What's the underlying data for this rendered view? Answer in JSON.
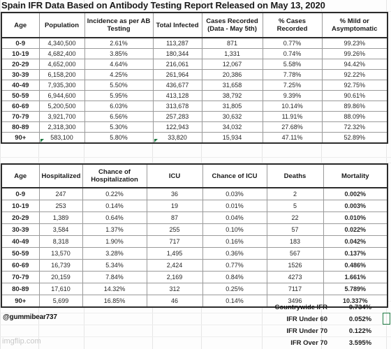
{
  "document": {
    "title": "Spain IFR Data Based on Antibody Testing Report Released on May 13, 2020",
    "username": "@gummibear737",
    "watermark": "imgflip.com",
    "accent_green": "#1f7a43",
    "border_color": "#2b2b2b"
  },
  "table_ifr": {
    "name": "Spain IFR antibody testing table",
    "headers": [
      "Age",
      "Population",
      "Incidence as per AB Testing",
      "Total Infected",
      "Cases Recorded (Data - May 5th)",
      "% Cases Recorded",
      "% Mild or Asymptomatic"
    ],
    "rows": [
      {
        "age": "0-9",
        "population": "4,340,500",
        "incidence": "2.61%",
        "total_infected": "113,287",
        "cases_recorded": "871",
        "pct_cases_recorded": "0.77%",
        "pct_mild": "99.23%"
      },
      {
        "age": "10-19",
        "population": "4,682,400",
        "incidence": "3.85%",
        "total_infected": "180,344",
        "cases_recorded": "1,331",
        "pct_cases_recorded": "0.74%",
        "pct_mild": "99.26%"
      },
      {
        "age": "20-29",
        "population": "4,652,000",
        "incidence": "4.64%",
        "total_infected": "216,061",
        "cases_recorded": "12,067",
        "pct_cases_recorded": "5.58%",
        "pct_mild": "94.42%"
      },
      {
        "age": "30-39",
        "population": "6,158,200",
        "incidence": "4.25%",
        "total_infected": "261,964",
        "cases_recorded": "20,386",
        "pct_cases_recorded": "7.78%",
        "pct_mild": "92.22%"
      },
      {
        "age": "40-49",
        "population": "7,935,300",
        "incidence": "5.50%",
        "total_infected": "436,677",
        "cases_recorded": "31,658",
        "pct_cases_recorded": "7.25%",
        "pct_mild": "92.75%"
      },
      {
        "age": "50-59",
        "population": "6,944,600",
        "incidence": "5.95%",
        "total_infected": "413,128",
        "cases_recorded": "38,792",
        "pct_cases_recorded": "9.39%",
        "pct_mild": "90.61%"
      },
      {
        "age": "60-69",
        "population": "5,200,500",
        "incidence": "6.03%",
        "total_infected": "313,678",
        "cases_recorded": "31,805",
        "pct_cases_recorded": "10.14%",
        "pct_mild": "89.86%"
      },
      {
        "age": "70-79",
        "population": "3,921,700",
        "incidence": "6.56%",
        "total_infected": "257,283",
        "cases_recorded": "30,632",
        "pct_cases_recorded": "11.91%",
        "pct_mild": "88.09%"
      },
      {
        "age": "80-89",
        "population": "2,318,300",
        "incidence": "5.30%",
        "total_infected": "122,943",
        "cases_recorded": "34,032",
        "pct_cases_recorded": "27.68%",
        "pct_mild": "72.32%"
      },
      {
        "age": "90+",
        "population": "583,100",
        "incidence": "5.80%",
        "total_infected": "33,820",
        "cases_recorded": "15,934",
        "pct_cases_recorded": "47.11%",
        "pct_mild": "52.89%"
      }
    ]
  },
  "table_severity": {
    "name": "Hospitalization ICU deaths mortality table",
    "headers": [
      "Age",
      "Hospitalized",
      "Chance of Hospitalization",
      "ICU",
      "Chance of ICU",
      "Deaths",
      "Mortality"
    ],
    "rows": [
      {
        "age": "0-9",
        "hospitalized": "247",
        "chance_hosp": "0.22%",
        "icu": "36",
        "chance_icu": "0.03%",
        "deaths": "2",
        "mortality": "0.002%"
      },
      {
        "age": "10-19",
        "hospitalized": "253",
        "chance_hosp": "0.14%",
        "icu": "19",
        "chance_icu": "0.01%",
        "deaths": "5",
        "mortality": "0.003%"
      },
      {
        "age": "20-29",
        "hospitalized": "1,389",
        "chance_hosp": "0.64%",
        "icu": "87",
        "chance_icu": "0.04%",
        "deaths": "22",
        "mortality": "0.010%"
      },
      {
        "age": "30-39",
        "hospitalized": "3,584",
        "chance_hosp": "1.37%",
        "icu": "255",
        "chance_icu": "0.10%",
        "deaths": "57",
        "mortality": "0.022%"
      },
      {
        "age": "40-49",
        "hospitalized": "8,318",
        "chance_hosp": "1.90%",
        "icu": "717",
        "chance_icu": "0.16%",
        "deaths": "183",
        "mortality": "0.042%"
      },
      {
        "age": "50-59",
        "hospitalized": "13,570",
        "chance_hosp": "3.28%",
        "icu": "1,495",
        "chance_icu": "0.36%",
        "deaths": "567",
        "mortality": "0.137%"
      },
      {
        "age": "60-69",
        "hospitalized": "16,739",
        "chance_hosp": "5.34%",
        "icu": "2,424",
        "chance_icu": "0.77%",
        "deaths": "1526",
        "mortality": "0.486%"
      },
      {
        "age": "70-79",
        "hospitalized": "20,159",
        "chance_hosp": "7.84%",
        "icu": "2,169",
        "chance_icu": "0.84%",
        "deaths": "4273",
        "mortality": "1.661%"
      },
      {
        "age": "80-89",
        "hospitalized": "17,610",
        "chance_hosp": "14.32%",
        "icu": "312",
        "chance_icu": "0.25%",
        "deaths": "7117",
        "mortality": "5.789%"
      },
      {
        "age": "90+",
        "hospitalized": "5,699",
        "chance_hosp": "16.85%",
        "icu": "46",
        "chance_icu": "0.14%",
        "deaths": "3496",
        "mortality": "10.337%"
      }
    ]
  },
  "summary": {
    "rows": [
      {
        "label": "Countrywide IFR",
        "value": "0.734%"
      },
      {
        "label": "IFR Under 60",
        "value": "0.052%"
      },
      {
        "label": "IFR Under 70",
        "value": "0.122%"
      },
      {
        "label": "IFR Over 70",
        "value": "3.595%"
      }
    ]
  }
}
